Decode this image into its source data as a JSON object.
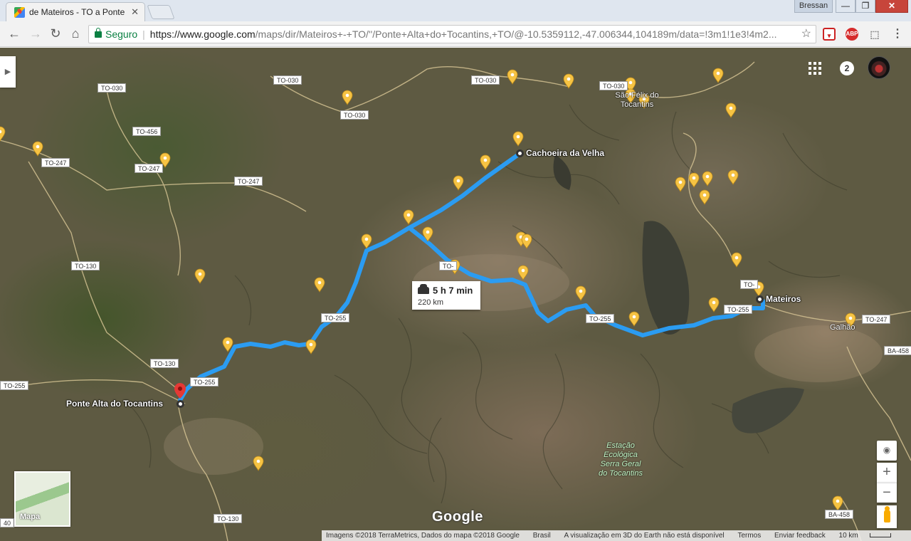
{
  "browser": {
    "tab_title": "de Mateiros - TO a Ponte",
    "user": "Bressan",
    "secure_label": "Seguro",
    "url_host": "https://www.google.com",
    "url_path": "/maps/dir/Mateiros+-+TO/''/Ponte+Alta+do+Tocantins,+TO/@-10.5359112,-47.006344,104189m/data=!3m1!1e3!4m2...",
    "ext_abp": "ABP",
    "window_buttons": {
      "min": "—",
      "max": "❐",
      "close": "✕"
    }
  },
  "map": {
    "notification_count": "2",
    "route_summary": {
      "duration": "5 h 7 min",
      "distance": "220 km"
    },
    "places": {
      "origin": "Mateiros",
      "waypoint": "Cachoeira da Velha",
      "destination": "Ponte Alta do Tocantins",
      "town1": "São Félix do Tocantins",
      "town2": "Galhão"
    },
    "station": [
      "Estação",
      "Ecológica",
      "Serra Geral",
      "do Tocantins"
    ],
    "road_shields": {
      "to030_a": "TO-030",
      "to030_b": "TO-030",
      "to030_c": "TO-030",
      "to030_d": "TO-030",
      "to030_e": "TO-030",
      "to456": "TO-456",
      "to247_a": "TO-247",
      "to247_b": "TO-247",
      "to247_c": "TO-247",
      "to247_d": "TO-247",
      "to130_a": "TO-130",
      "to130_b": "TO-130",
      "to130_c": "TO-130",
      "to255_a": "TO-255",
      "to255_b": "TO-255",
      "to255_c": "TO-255",
      "to255_d": "TO-255",
      "to255_e": "TO-255",
      "to255_f": "TO-255",
      "ba458_a": "BA-458",
      "ba458_b": "BA-458",
      "to_partial": "TO-",
      "to_edge": "TO-",
      "to_cut": "40"
    },
    "minimap_label": "Mapa",
    "google_logo": "Google",
    "footer": {
      "imagery": "Imagens ©2018 TerraMetrics, Dados do mapa ©2018 Google",
      "country": "Brasil",
      "earth_msg": "A visualização em 3D do Earth não está disponível",
      "terms": "Termos",
      "feedback": "Enviar feedback",
      "scale": "10 km"
    },
    "colors": {
      "route": "#2b9cf2",
      "pin": "#f6c343",
      "dest_pin": "#e53935"
    }
  }
}
